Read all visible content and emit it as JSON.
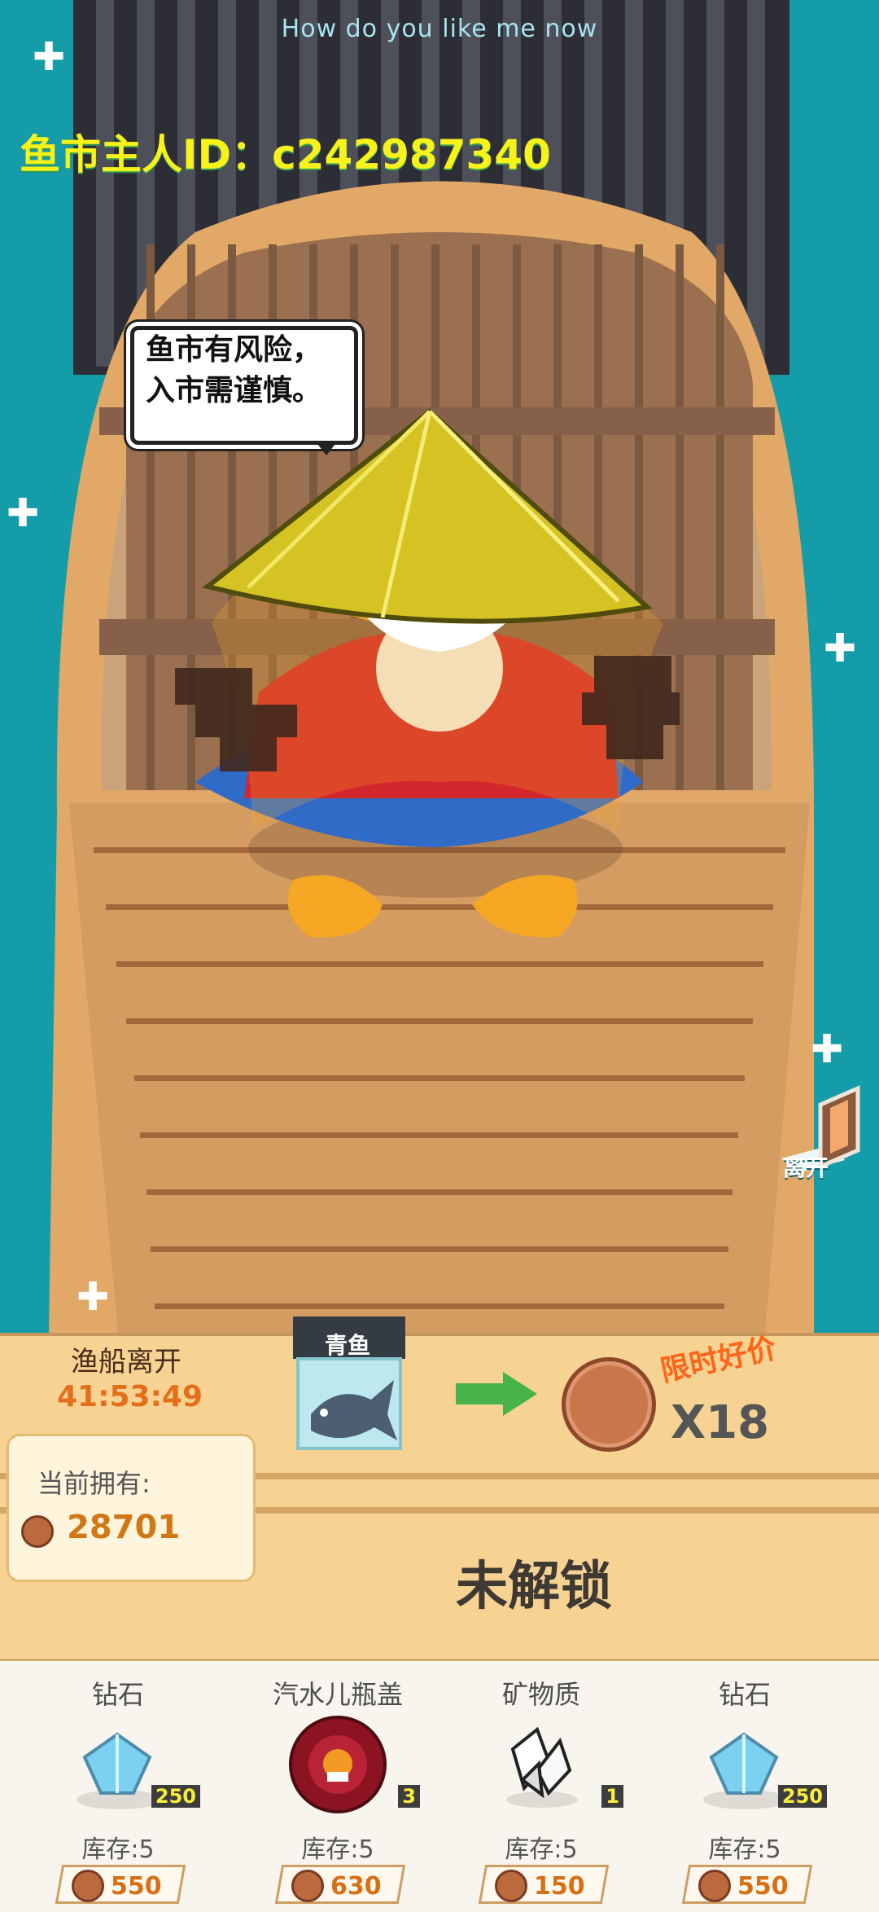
{
  "header": {
    "title": "How do you like me now",
    "owner_id": "鱼市主人ID：c242987340"
  },
  "bubble": {
    "line1": "鱼市有风险，",
    "line2": "入市需谨慎。"
  },
  "side": {
    "leave_label": "离开"
  },
  "trade": {
    "boat_leave_label": "渔船离开",
    "countdown": "41:53:49",
    "owned_label": "当前拥有:",
    "owned_value": "28701",
    "fish_label": "青鱼",
    "limit_label": "限时好价",
    "multiplier": "X18",
    "locked_label": "未解锁"
  },
  "shop": {
    "items": [
      {
        "name": "钻石",
        "stock": "库存:5",
        "price": "550",
        "badge": "250",
        "icon": "diamond-icon"
      },
      {
        "name": "汽水儿瓶盖",
        "stock": "库存:5",
        "price": "630",
        "badge": "3",
        "icon": "bottle-cap-icon"
      },
      {
        "name": "矿物质",
        "stock": "库存:5",
        "price": "150",
        "badge": "1",
        "icon": "mineral-icon"
      },
      {
        "name": "钻石",
        "stock": "库存:5",
        "price": "550",
        "badge": "250",
        "icon": "diamond-icon"
      }
    ]
  },
  "colors": {
    "sea": "#149ca9",
    "wood": "#d89b5a",
    "accent": "#e46e1a"
  }
}
